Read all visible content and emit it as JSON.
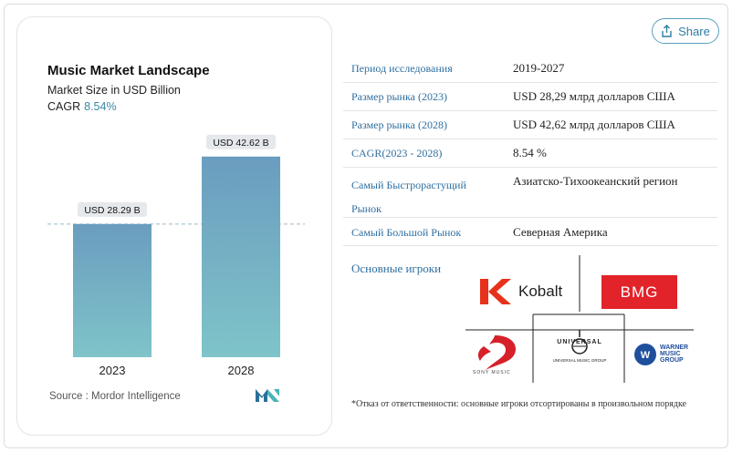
{
  "share": {
    "label": "Share"
  },
  "chart_data": {
    "type": "bar",
    "title": "Music Market Landscape",
    "subtitle": "Market Size in USD Billion",
    "cagr_label": "CAGR",
    "cagr_value": "8.54%",
    "categories": [
      "2023",
      "2028"
    ],
    "values": [
      28.29,
      42.62
    ],
    "data_labels": [
      "USD 28.29 B",
      "USD 42.62 B"
    ],
    "ylim": [
      0,
      48
    ],
    "reference_line": 28.29,
    "bar_color_top": "#6a9dbf",
    "bar_color_bottom": "#7fc4c9",
    "source": "Source :  Mordor Intelligence"
  },
  "table": {
    "rows": [
      {
        "label": "Период исследования",
        "value": "2019-2027"
      },
      {
        "label": "Размер рынка (2023)",
        "value": "USD 28,29 млрд долларов США"
      },
      {
        "label": "Размер рынка (2028)",
        "value": "USD 42,62 млрд долларов США"
      },
      {
        "label": "CAGR(2023 - 2028)",
        "value": "8.54 %"
      },
      {
        "label": "Самый Быстрорастущий Рынок",
        "value": "Азиатско-Тихоокеанский регион"
      },
      {
        "label": "Самый Большой Рынок",
        "value": "Северная Америка"
      }
    ],
    "players_label": "Основные игроки"
  },
  "players": {
    "kobalt": "Kobalt",
    "bmg": "BMG",
    "sony": "SONY MUSIC",
    "universal": "UNIVERSAL",
    "universal_sub": "UNIVERSAL MUSIC GROUP",
    "warner_1": "WARNER",
    "warner_2": "MUSIC",
    "warner_3": "GROUP"
  },
  "disclaimer": "*Отказ от ответственности: основные игроки отсортированы в произвольном порядке",
  "colors": {
    "accent": "#2f6fa0",
    "bmg_red": "#e2232a",
    "kobalt_red": "#e8311a",
    "sony_red": "#d6202a",
    "warner_blue": "#1f4f9c"
  }
}
